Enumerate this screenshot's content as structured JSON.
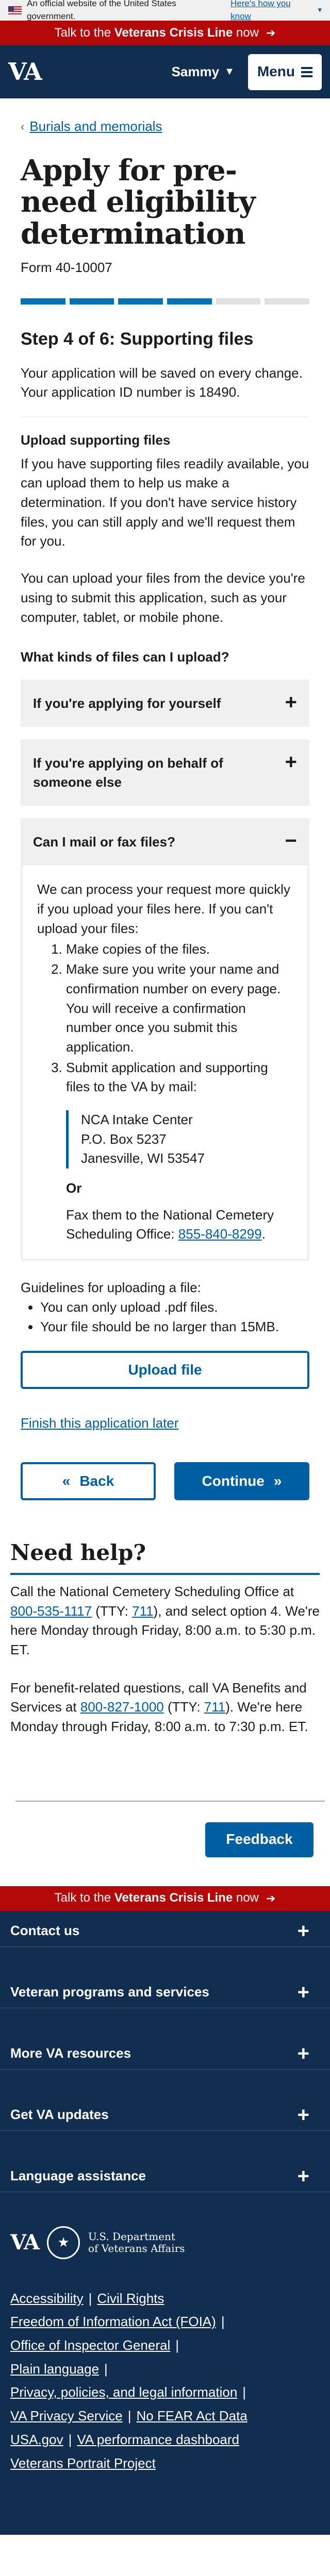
{
  "gov_banner": {
    "text": "An official website of the United States government.",
    "link": "Here's how you know"
  },
  "crisis": {
    "prefix": "Talk to the",
    "bold": "Veterans Crisis Line",
    "suffix": "now"
  },
  "header": {
    "logo": "VA",
    "user": "Sammy",
    "menu": "Menu"
  },
  "breadcrumb": {
    "label": "Burials and memorials"
  },
  "page": {
    "title": "Apply for pre-need eligibility determination",
    "form_number": "Form 40-10007",
    "progress": {
      "total_steps": 6,
      "current_step": 4
    },
    "step_title": "Step 4 of 6: Supporting files",
    "save_message": "Your application will be saved on every change. Your application ID number is 18490.",
    "upload_heading": "Upload supporting files",
    "upload_p1": "If you have supporting files readily available, you can upload them to help us make a determination. If you don't have service history files, you can still apply and we'll request them for you.",
    "upload_p2": "You can upload your files from the device you're using to submit this application, such as your computer, tablet, or mobile phone.",
    "kinds_heading": "What kinds of files can I upload?"
  },
  "accordions": {
    "a1": "If you're applying for yourself",
    "a2": "If you're applying on behalf of someone else",
    "a3": "Can I mail or fax files?"
  },
  "mail": {
    "intro": "We can process your request more quickly if you upload your files here. If you can't upload your files:",
    "step1": "Make copies of the files.",
    "step2": "Make sure you write your name and confirmation number on every page. You will receive a confirmation number once you submit this application.",
    "step3": "Submit application and supporting files to the VA by mail:",
    "addr1": "NCA Intake Center",
    "addr2": "P.O. Box 5237",
    "addr3": "Janesville, WI 53547",
    "or": "Or",
    "fax_text": "Fax them to the National Cemetery Scheduling Office:",
    "fax_number": "855-840-8299"
  },
  "guidelines": {
    "heading": "Guidelines for uploading a file:",
    "item1": "You can only upload .pdf files.",
    "item2": "Your file should be no larger than 15MB."
  },
  "buttons": {
    "upload": "Upload file",
    "finish_later": "Finish this application later",
    "back": "Back",
    "continue": "Continue",
    "feedback": "Feedback"
  },
  "help": {
    "heading": "Need help?",
    "p1_a": "Call the National Cemetery Scheduling Office at",
    "p1_phone": "800-535-1117",
    "p1_tty_pre": "(TTY:",
    "p1_tty": "711",
    "p1_b": "), and select option 4. We're here Monday through Friday, 8:00 a.m. to 5:30 p.m. ET.",
    "p2_a": "For benefit-related questions, call VA Benefits and Services at",
    "p2_phone": "800-827-1000",
    "p2_tty_pre": "(TTY:",
    "p2_tty": "711",
    "p2_b": "). We're here Monday through Friday, 8:00 a.m. to 7:30 p.m. ET."
  },
  "footer": {
    "sections": [
      "Contact us",
      "Veteran programs and services",
      "More VA resources",
      "Get VA updates",
      "Language assistance"
    ],
    "dept_line1": "U.S. Department",
    "dept_line2": "of Veterans Affairs",
    "links": {
      "accessibility": "Accessibility",
      "civil_rights": "Civil Rights",
      "foia": "Freedom of Information Act (FOIA)",
      "oig": "Office of Inspector General",
      "plain_language": "Plain language",
      "privacy_policies": "Privacy, policies, and legal information",
      "privacy_service": "VA Privacy Service",
      "no_fear": "No FEAR Act Data",
      "usa_gov": "USA.gov",
      "performance": "VA performance dashboard",
      "portrait": "Veterans Portrait Project"
    }
  },
  "colors": {
    "primary": "#005ea2",
    "header_bg": "#112e51",
    "crisis_bg": "#b50909",
    "progress_done": "#0071bb"
  }
}
